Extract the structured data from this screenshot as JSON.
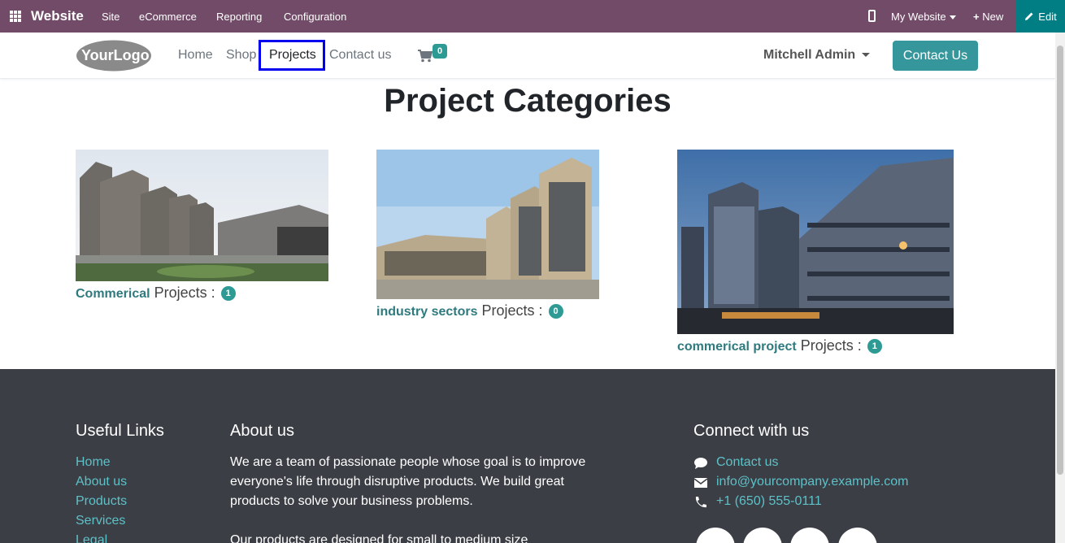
{
  "admin_bar": {
    "brand": "Website",
    "menu": [
      "Site",
      "eCommerce",
      "Reporting",
      "Configuration"
    ],
    "website_selector": "My Website",
    "new_label": "New",
    "edit_label": "Edit",
    "color": "#714B67",
    "edit_color": "#017E84"
  },
  "header": {
    "logo_text": "YourLogo",
    "nav": [
      {
        "label": "Home"
      },
      {
        "label": "Shop"
      },
      {
        "label": "Projects",
        "active": true
      },
      {
        "label": "Contact us"
      }
    ],
    "cart_count": "0",
    "user_name": "Mitchell Admin",
    "contact_button": "Contact Us",
    "accent_color": "#35979c"
  },
  "main": {
    "title": "Project Categories",
    "projects_label": "Projects :",
    "categories": [
      {
        "name": "Commerical",
        "count": "1",
        "image": "office-campus-photo"
      },
      {
        "name": "industry sectors",
        "count": "0",
        "image": "office-towers-photo"
      },
      {
        "name": "commerical project",
        "count": "1",
        "image": "night-office-building-photo"
      }
    ]
  },
  "footer": {
    "useful_links": {
      "title": "Useful Links",
      "items": [
        "Home",
        "About us",
        "Products",
        "Services",
        "Legal"
      ]
    },
    "about": {
      "title": "About us",
      "text": "We are a team of passionate people whose goal is to improve everyone's life through disruptive products. We build great products to solve your business problems.",
      "text2": "Our products are designed for small to medium size"
    },
    "connect": {
      "title": "Connect with us",
      "items": [
        {
          "icon": "comment-icon",
          "text": "Contact us"
        },
        {
          "icon": "envelope-icon",
          "text": "info@yourcompany.example.com"
        },
        {
          "icon": "phone-icon",
          "text": "+1 (650) 555-0111"
        }
      ]
    },
    "background": "#3b3e45",
    "link_color": "#5dc1c8"
  }
}
